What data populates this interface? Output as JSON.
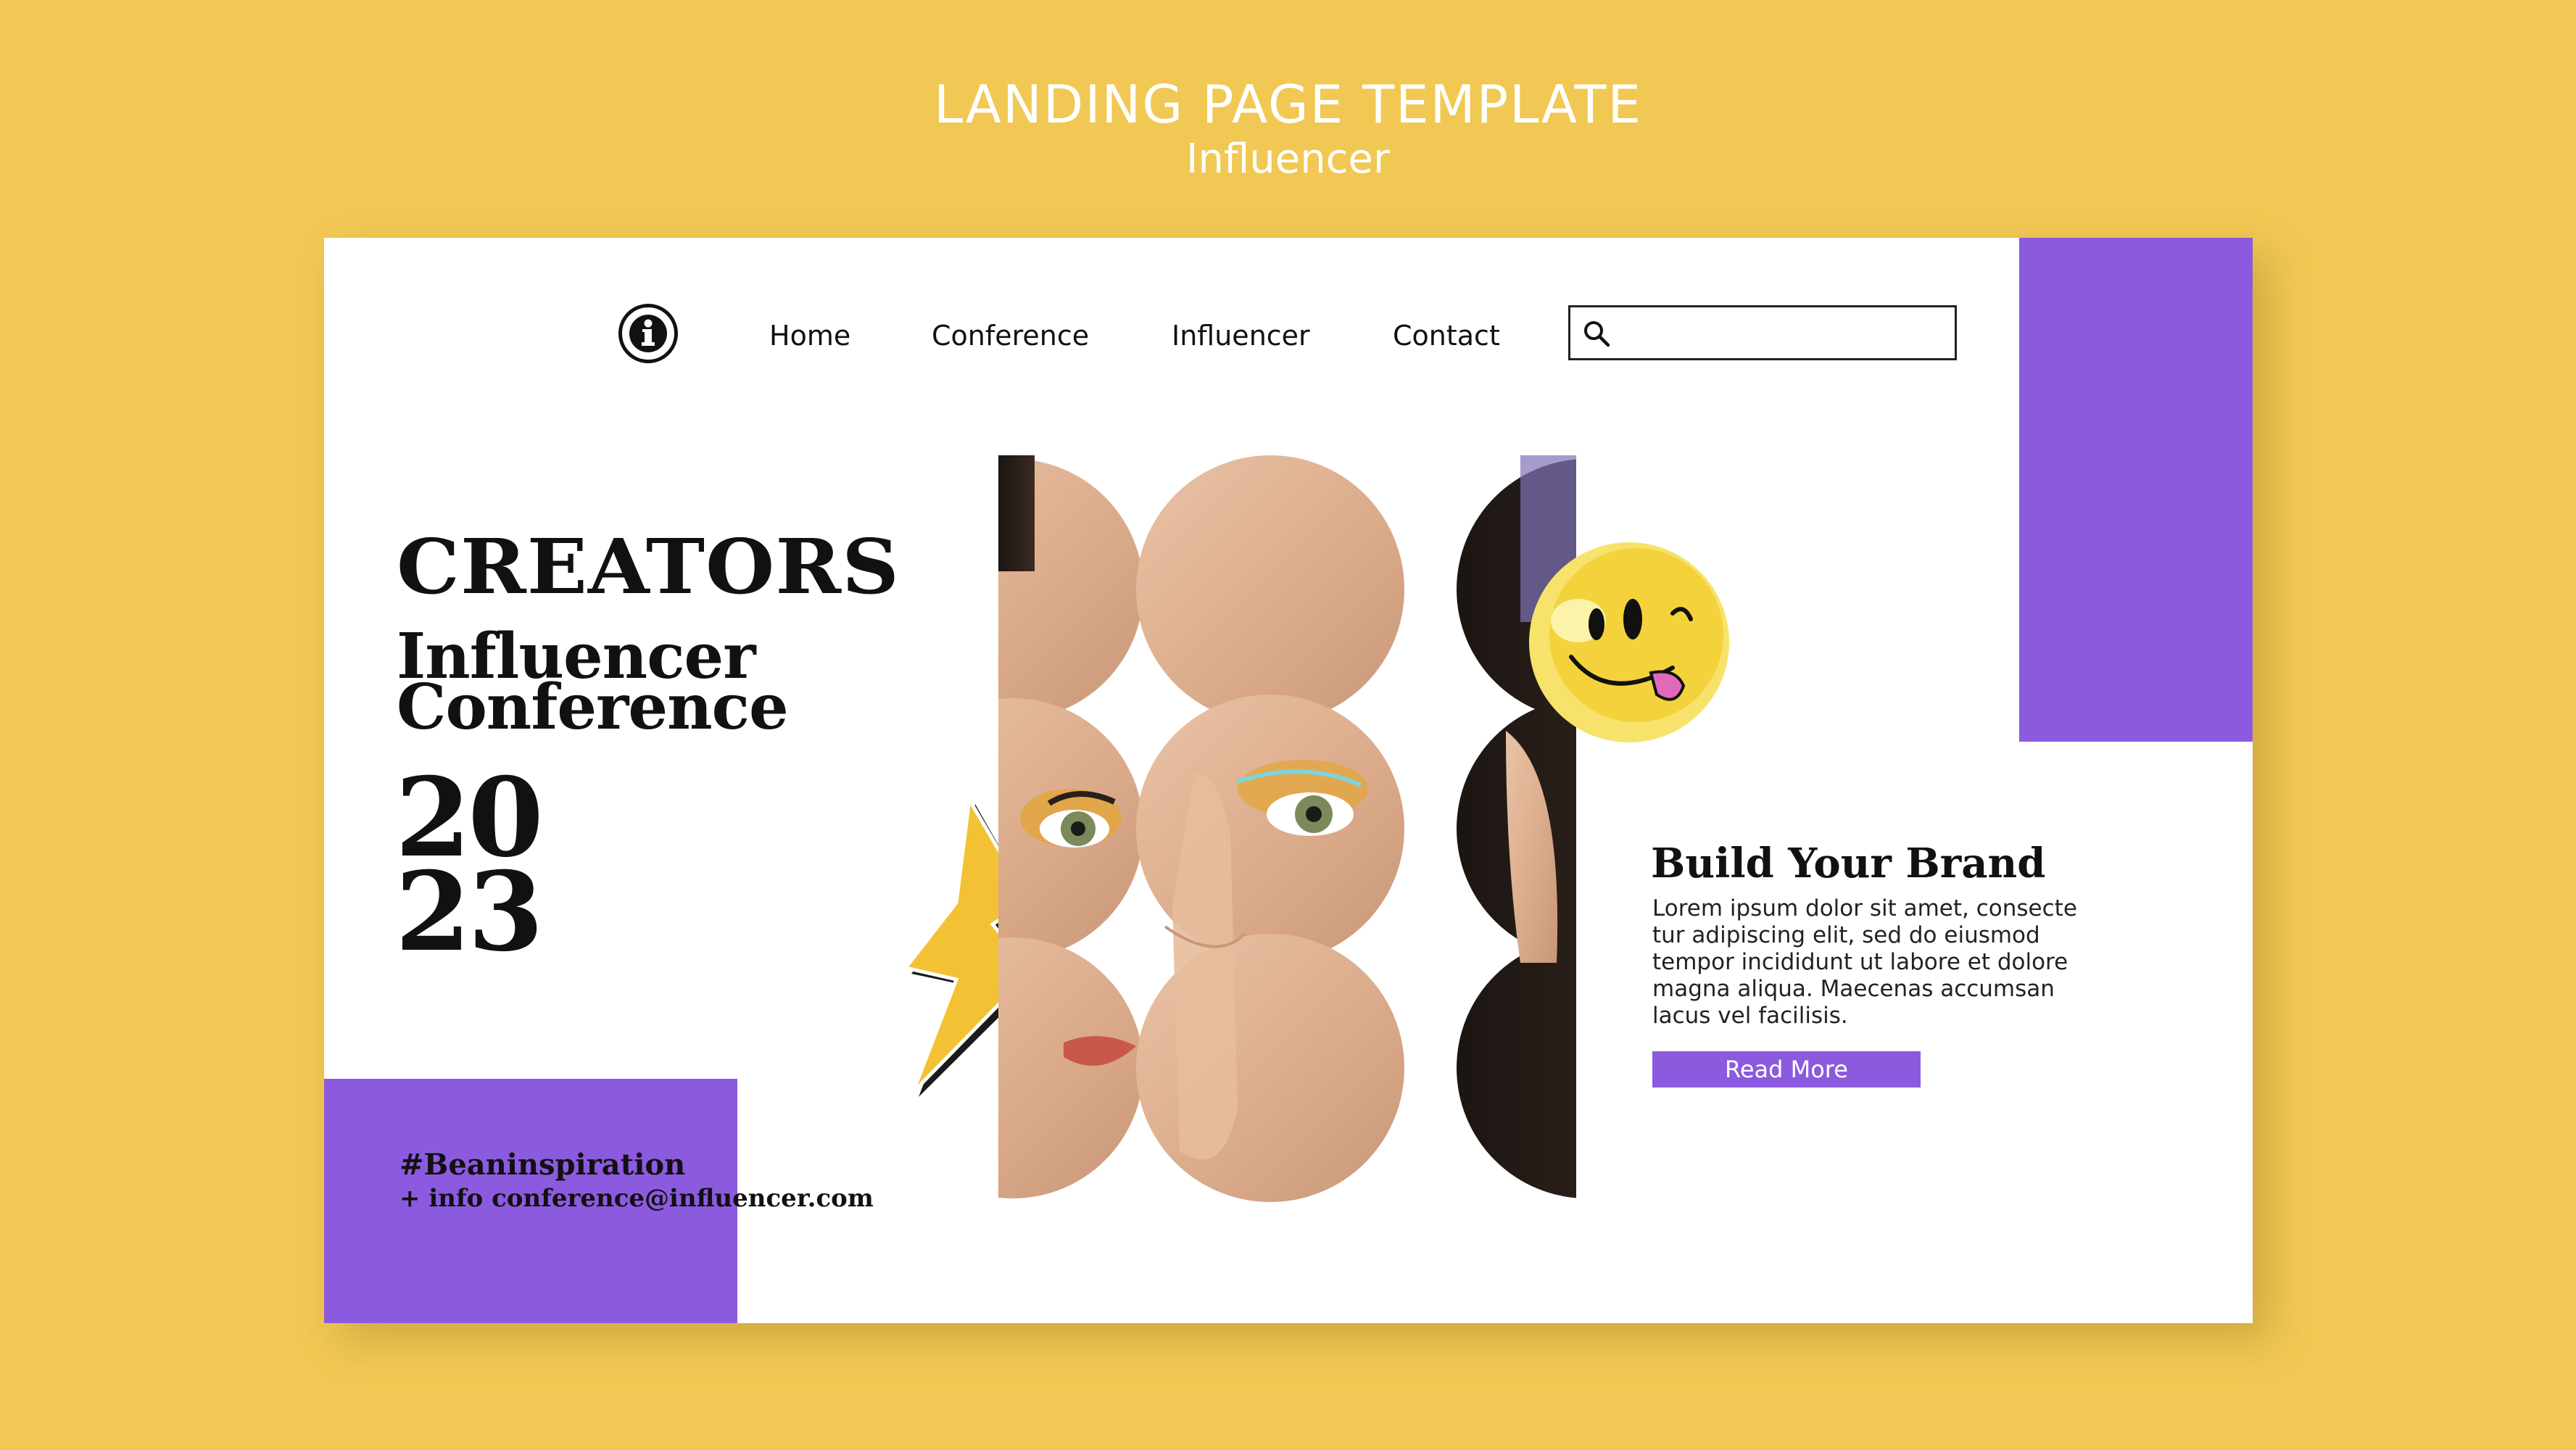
{
  "header": {
    "title": "LANDING PAGE TEMPLATE",
    "subtitle": "Influencer"
  },
  "nav": {
    "logo_icon": "info-icon",
    "items": [
      {
        "label": "Home"
      },
      {
        "label": "Conference"
      },
      {
        "label": "Influencer"
      },
      {
        "label": "Contact"
      }
    ],
    "search": {
      "icon": "search-icon",
      "value": "",
      "placeholder": ""
    }
  },
  "hero": {
    "headline": "CREATORS",
    "subheadline_line1": "Influencer",
    "subheadline_line2": "Conference",
    "year_line1": "20",
    "year_line2": "23",
    "hashtag": "#Beaninspiration",
    "info": "+ info conference@influencer.com"
  },
  "brand": {
    "title": "Build Your Brand",
    "body": "Lorem ipsum dolor sit amet, consecte tur adipiscing elit, sed do eiusmod tempor incididunt ut labore et dolore magna aliqua. Maecenas accumsan lacus vel facilisis.",
    "button_label": "Read More"
  },
  "decorations": {
    "lightning_icon": "lightning-bolt-icon",
    "smiley_icon": "smiley-tongue-icon"
  },
  "colors": {
    "background": "#F1C853",
    "accent": "#8C5ADF",
    "text": "#111111"
  }
}
